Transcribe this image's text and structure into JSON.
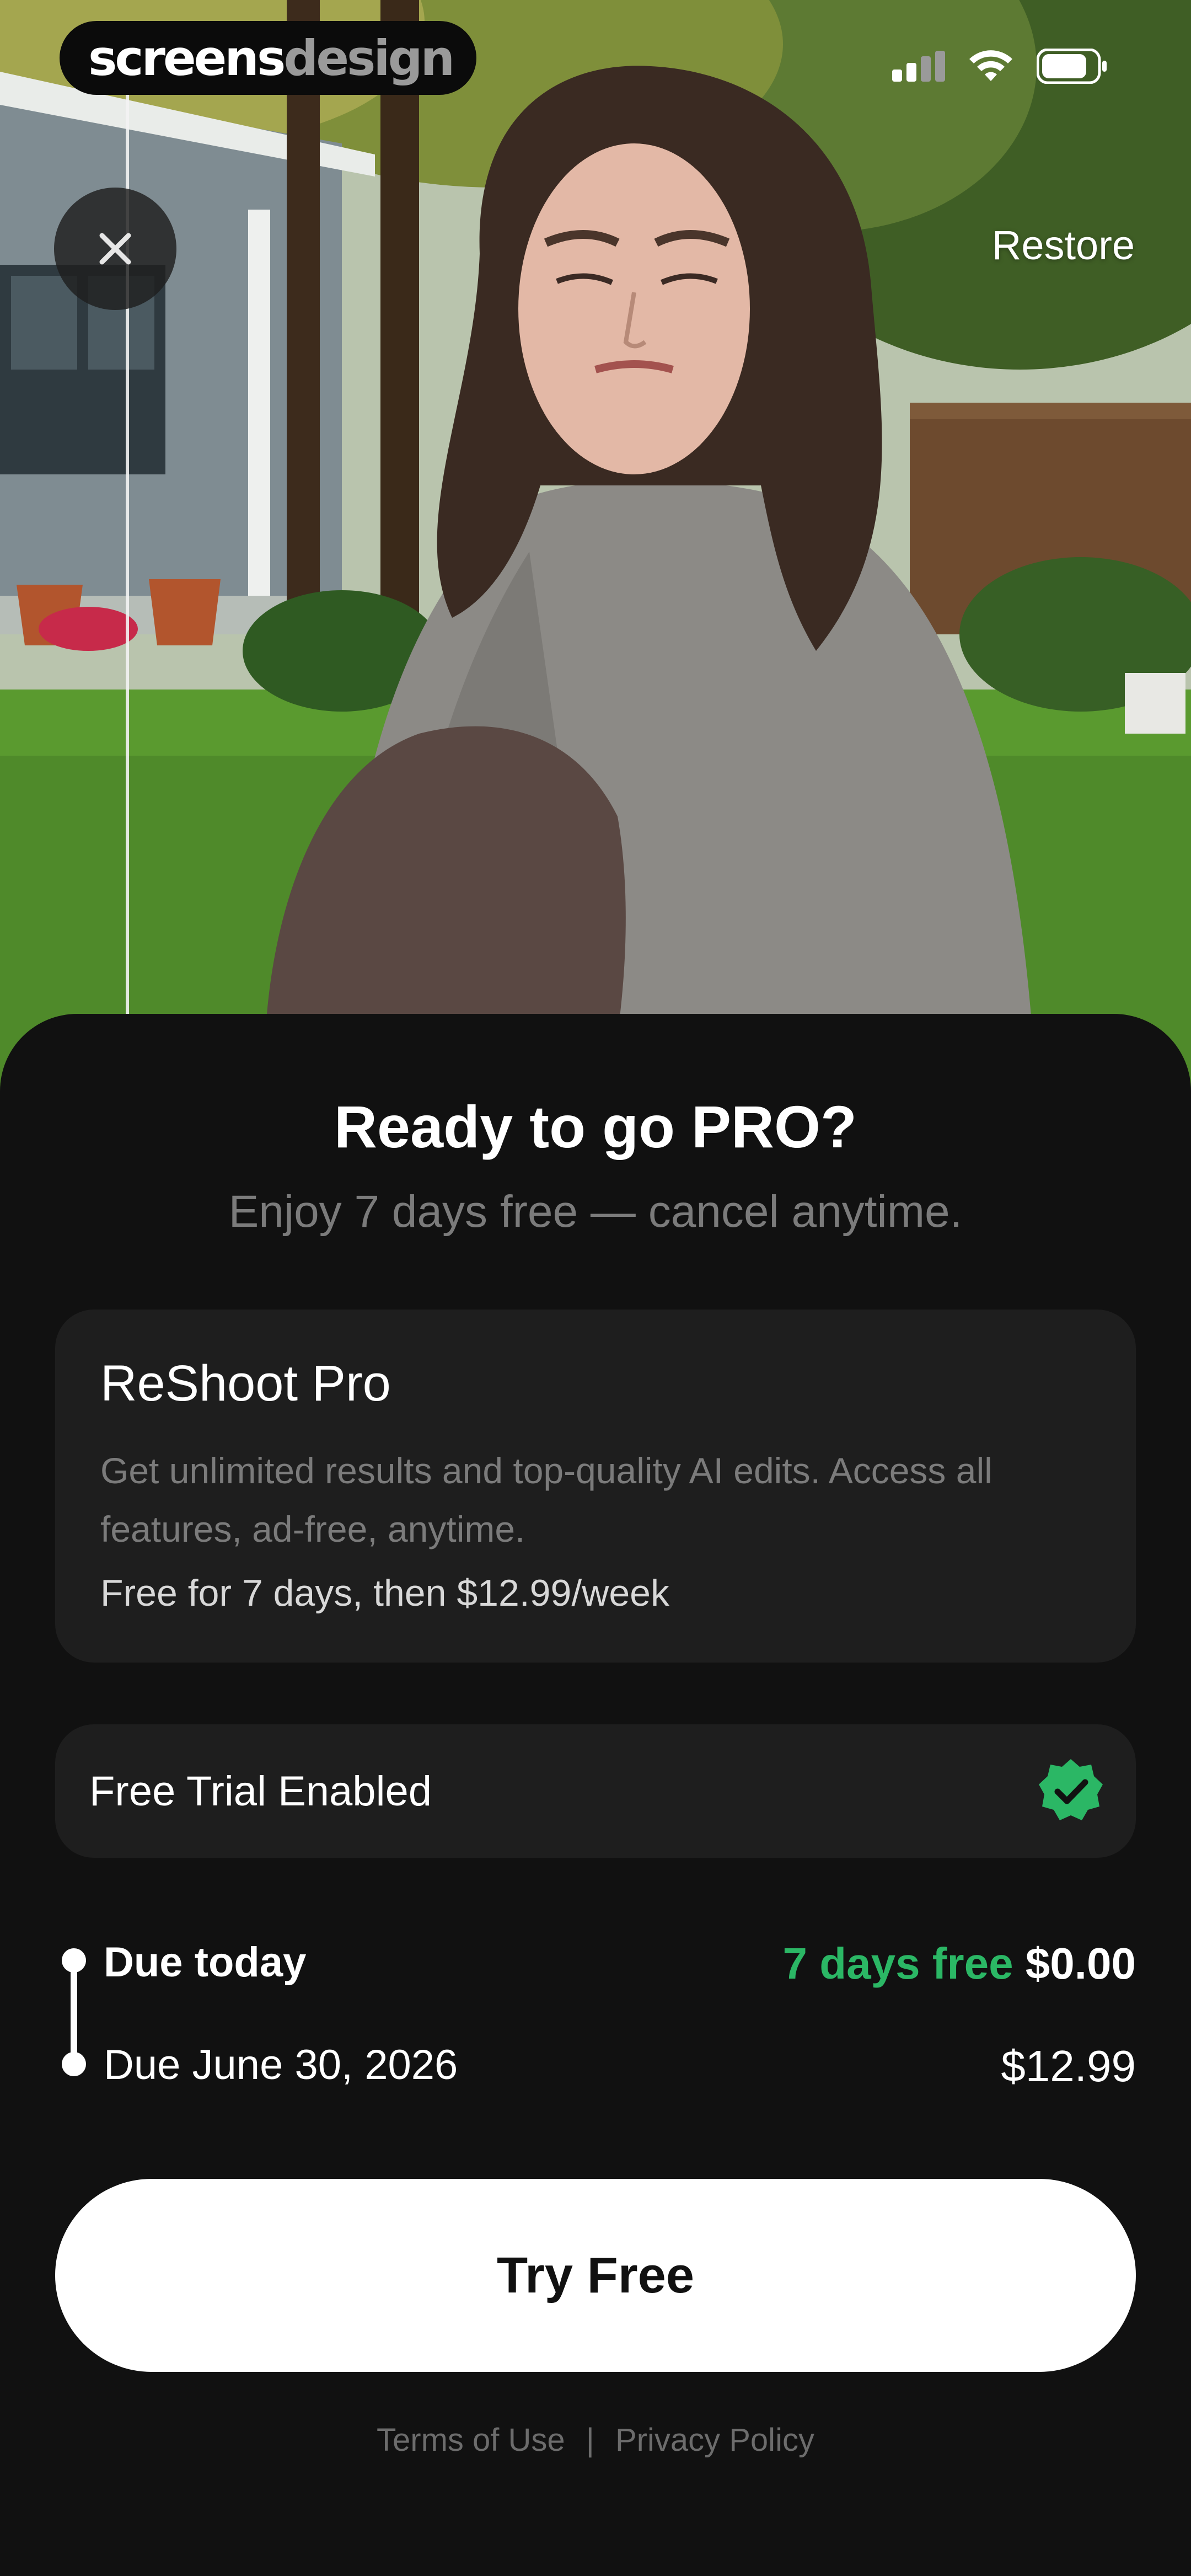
{
  "status_bar": {
    "brand_part1": "screens",
    "brand_part2": "design"
  },
  "top_bar": {
    "close_icon": "close-icon",
    "restore_label": "Restore"
  },
  "paywall": {
    "headline": "Ready to go PRO?",
    "subhead": "Enjoy 7 days free — cancel anytime.",
    "plan": {
      "title": "ReShoot Pro",
      "description": "Get unlimited results and top-quality AI edits. Access all features, ad-free, anytime.",
      "price_line": "Free for 7 days, then $12.99/week"
    },
    "trial_toggle": {
      "label": "Free Trial Enabled",
      "icon": "verified-check-icon",
      "enabled": true
    },
    "timeline": {
      "due_today_label": "Due today",
      "due_today_promo": "7 days free",
      "due_today_amount": "$0.00",
      "due_later_label": "Due June 30, 2026",
      "due_later_amount": "$12.99"
    },
    "cta_label": "Try Free",
    "footer": {
      "terms": "Terms of Use",
      "separator": "|",
      "privacy": "Privacy Policy"
    }
  },
  "colors": {
    "background": "#111111",
    "card": "#1e1e1e",
    "accent_green": "#2bb765",
    "muted_text": "#7b7b7b"
  }
}
